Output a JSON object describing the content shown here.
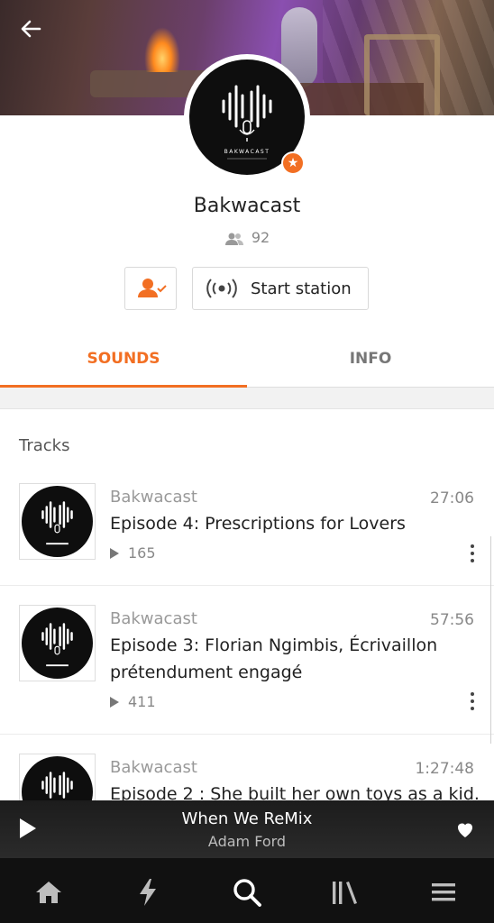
{
  "header": {
    "back_icon": "arrow-left-icon"
  },
  "profile": {
    "name": "Bakwacast",
    "followers": "92",
    "logo_text": "BAKWACAST"
  },
  "actions": {
    "station_label": "Start station"
  },
  "tabs": [
    {
      "label": "SOUNDS",
      "active": true
    },
    {
      "label": "INFO",
      "active": false
    }
  ],
  "section_title": "Tracks",
  "tracks": [
    {
      "user": "Bakwacast",
      "duration": "27:06",
      "title": "Episode 4: Prescriptions for Lovers",
      "plays": "165"
    },
    {
      "user": "Bakwacast",
      "duration": "57:56",
      "title": "Episode 3: Florian Ngimbis, Écrivaillon prétendument engagé",
      "plays": "411"
    },
    {
      "user": "Bakwacast",
      "duration": "1:27:48",
      "title": "Episode 2 : She built her own toys as a kid.",
      "plays": ""
    }
  ],
  "player": {
    "song": "When We ReMix",
    "artist": "Adam Ford"
  },
  "colors": {
    "accent": "#f26f23",
    "dark": "#111111"
  }
}
